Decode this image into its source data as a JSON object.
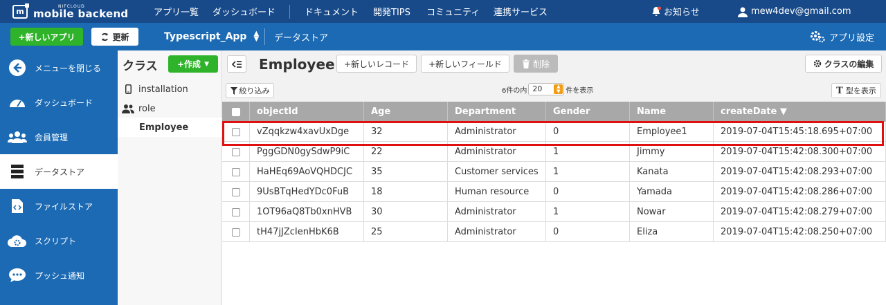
{
  "brand": {
    "sub": "NIFCLOUD",
    "name": "mobile backend",
    "mark": "m"
  },
  "topnav": {
    "items": [
      "アプリ一覧",
      "ダッシュボード",
      "ドキュメント",
      "開発TIPS",
      "コミュニティ",
      "連携サービス"
    ],
    "notifications": "お知らせ",
    "user": "mew4dev@gmail.com"
  },
  "subbar": {
    "new_app": "+新しいアプリ",
    "refresh": "更新",
    "app_name": "Typescript_App",
    "breadcrumb": "データストア",
    "app_settings": "アプリ設定"
  },
  "sidebar": {
    "items": [
      {
        "label": "メニューを閉じる",
        "icon": "arrow-left-circle-icon"
      },
      {
        "label": "ダッシュボード",
        "icon": "speedometer-icon"
      },
      {
        "label": "会員管理",
        "icon": "users-icon"
      },
      {
        "label": "データストア",
        "icon": "database-icon",
        "active": true
      },
      {
        "label": "ファイルストア",
        "icon": "file-code-icon"
      },
      {
        "label": "スクリプト",
        "icon": "cloud-gear-icon"
      },
      {
        "label": "プッシュ通知",
        "icon": "chat-bubble-icon"
      }
    ]
  },
  "classes": {
    "title": "クラス",
    "create": "+作成",
    "items": [
      {
        "label": "installation",
        "icon": "mobile-icon"
      },
      {
        "label": "role",
        "icon": "users-icon"
      },
      {
        "label": "Employee",
        "icon": "",
        "active": true
      }
    ]
  },
  "main": {
    "class_name": "Employee",
    "new_record": "+新しいレコード",
    "new_field": "+新しいフィールド",
    "delete": "削除",
    "edit_class": "クラスの編集",
    "filter": "絞り込み",
    "pager_prefix": "6件の内",
    "pager_value": "20",
    "pager_suffix": "件を表示",
    "type_view": "型を表示"
  },
  "table": {
    "columns": [
      "objectId",
      "Age",
      "Department",
      "Gender",
      "Name",
      "createDate ▼"
    ],
    "rows": [
      [
        "vZqqkzw4xavUxDge",
        "32",
        "Administrator",
        "0",
        "Employee1",
        "2019-07-04T15:45:18.695+07:00"
      ],
      [
        "PggGDN0gySdwP9iC",
        "22",
        "Administrator",
        "1",
        "Jimmy",
        "2019-07-04T15:42:08.300+07:00"
      ],
      [
        "HaHEq69AoVQHDCJC",
        "35",
        "Customer services",
        "1",
        "Kanata",
        "2019-07-04T15:42:08.293+07:00"
      ],
      [
        "9UsBTqHedYDc0FuB",
        "18",
        "Human resource",
        "0",
        "Yamada",
        "2019-07-04T15:42:08.286+07:00"
      ],
      [
        "1OT96aQ8Tb0xnHVB",
        "30",
        "Administrator",
        "1",
        "Nowar",
        "2019-07-04T15:42:08.279+07:00"
      ],
      [
        "tH47jJZcIenHbK6B",
        "25",
        "Administrator",
        "0",
        "Eliza",
        "2019-07-04T15:42:08.250+07:00"
      ]
    ]
  },
  "colors": {
    "topbar": "#184a8a",
    "sidebar": "#1b6ab3",
    "green": "#2fb32a",
    "highlight": "#e01010",
    "header_row": "#a8a8a8"
  }
}
